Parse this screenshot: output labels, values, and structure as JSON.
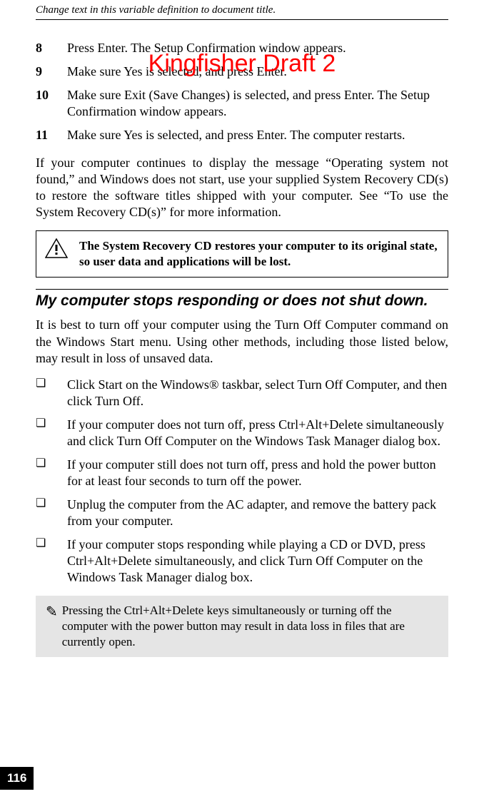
{
  "header": "Change text in this variable definition to document title.",
  "watermark": "Kingfisher Draft 2",
  "steps": [
    {
      "num": "8",
      "text": "Press Enter. The Setup Confirmation window appears."
    },
    {
      "num": "9",
      "text": "Make sure Yes is selected, and press Enter."
    },
    {
      "num": "10",
      "text": "Make sure Exit (Save Changes) is selected, and press Enter. The Setup Confirmation window appears."
    },
    {
      "num": "11",
      "text": "Make sure Yes is selected, and press Enter. The computer restarts."
    }
  ],
  "para1": "If your computer continues to display the message “Operating system not found,” and Windows does not start, use your supplied System Recovery CD(s) to restore the software titles shipped with your computer. See “To use the System Recovery CD(s)” for more information.",
  "caution": "The System Recovery CD restores your computer to its original state, so user data and applications will be lost.",
  "subheading": "My computer stops responding or does not shut down.",
  "para2": "It is best to turn off your computer using the Turn Off Computer command on the Windows Start menu. Using other methods, including those listed below, may result in loss of unsaved data.",
  "bullets": [
    "Click Start on the Windows® taskbar, select Turn Off Computer, and then click Turn Off.",
    "If your computer does not turn off, press Ctrl+Alt+Delete simultaneously and click Turn Off Computer on the Windows Task Manager dialog box.",
    "If your computer still does not turn off, press and hold the power button for at least four seconds to turn off the power.",
    "Unplug the computer from the AC adapter, and remove the battery pack from your computer.",
    "If your computer stops responding while playing a CD or DVD, press Ctrl+Alt+Delete simultaneously, and click Turn Off Computer on the Windows Task Manager dialog box."
  ],
  "note": "Pressing the Ctrl+Alt+Delete keys simultaneously or turning off the computer with the power button may result in data loss in files that are currently open.",
  "pagenum": "116",
  "bulletmark": "❏"
}
